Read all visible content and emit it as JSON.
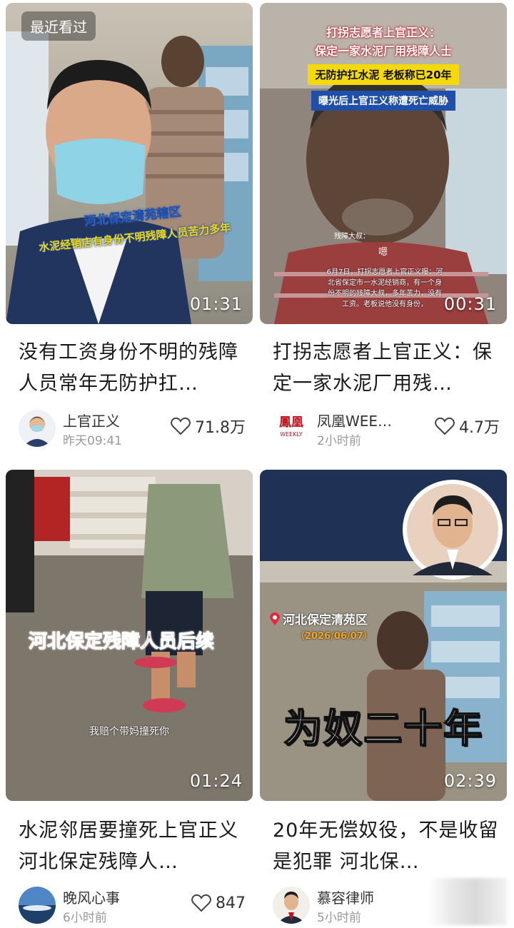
{
  "recent_badge": "最近看过",
  "cards": [
    {
      "duration": "01:31",
      "title": "没有工资身份不明的残障人员常年无防护扛…",
      "author": "上官正义",
      "time": "昨天09:41",
      "likes": "71.8万",
      "overlay": {
        "line1": "河北保定清苑辖区",
        "line2": "水泥经销店有身份不明残障人员苦力多年"
      }
    },
    {
      "duration": "00:31",
      "title": "打拐志愿者上官正义：保定一家水泥厂用残…",
      "author": "凤凰WEE…",
      "time": "2小时前",
      "likes": "4.7万",
      "logo_top": "鳳凰",
      "logo_bottom": "WEEKLY",
      "overlay": {
        "head1": "打拐志愿者上官正义：",
        "head2": "保定一家水泥厂用残障人士",
        "yellow": "无防护扛水泥 老板称已20年",
        "blue": "曝光后上官正义称遭死亡威胁",
        "speaker": "残障大叔：",
        "reply": "嗯",
        "caption": "6月7日，打拐志愿者上官正义曝：河北省保定市一水泥经销商，有一个身份不明的残障大叔，多年苦力，没有工资。老板说他没有身份，"
      }
    },
    {
      "duration": "01:24",
      "title": "水泥邻居要撞死上官正义 河北保定残障人…",
      "author": "晚风心事",
      "time": "6小时前",
      "likes": "847",
      "overlay": {
        "red": "河北保定残障人员后续",
        "subtitle": "我赔个带妈撞死你"
      }
    },
    {
      "duration": "02:39",
      "title": "20年无偿奴役，不是收留是犯罪 河北保…",
      "author": "慕容律师",
      "time": "5小时前",
      "likes": "",
      "overlay": {
        "location": "河北保定清苑区",
        "date": "（2026/06/07）",
        "big": "为奴二十年"
      }
    }
  ],
  "colors": {
    "overlay_yellow": "#f5d90a",
    "overlay_red": "#e8253a",
    "overlay_blue": "#1f4fa8"
  }
}
